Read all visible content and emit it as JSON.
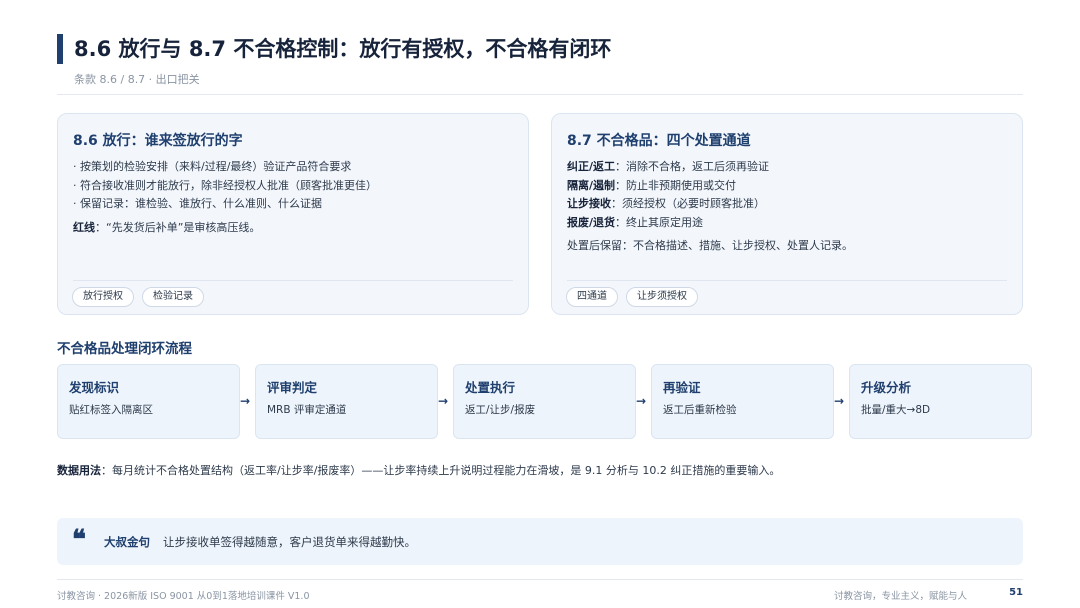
{
  "header": {
    "title": "8.6 放行与 8.7 不合格控制：放行有授权，不合格有闭环",
    "subtitle": "条款 8.6 / 8.7 · 出口把关"
  },
  "left_card": {
    "title": "8.6 放行：谁来签放行的字",
    "lines": [
      "· 按策划的检验安排（来料/过程/最终）验证产品符合要求",
      "· 符合接收准则才能放行，除非经授权人批准（顾客批准更佳）",
      "· 保留记录：谁检验、谁放行、什么准则、什么证据"
    ],
    "redline_label": "红线",
    "redline_text": "：“先发货后补单”是审核高压线。",
    "tags": [
      "放行授权",
      "检验记录"
    ]
  },
  "right_card": {
    "title": "8.7 不合格品：四个处置通道",
    "channels": [
      {
        "label": "纠正/返工",
        "text": "：消除不合格，返工后须再验证"
      },
      {
        "label": "隔离/遏制",
        "text": "：防止非预期使用或交付"
      },
      {
        "label": "让步接收",
        "text": "：须经授权（必要时顾客批准）"
      },
      {
        "label": "报废/退货",
        "text": "：终止其原定用途"
      }
    ],
    "note": "处置后保留：不合格描述、措施、让步授权、处置人记录。",
    "tags": [
      "四通道",
      "让步须授权"
    ]
  },
  "flow": {
    "title": "不合格品处理闭环流程",
    "steps": [
      {
        "title": "发现标识",
        "desc": "贴红标签入隔离区"
      },
      {
        "title": "评审判定",
        "desc": "MRB 评审定通道"
      },
      {
        "title": "处置执行",
        "desc": "返工/让步/报废"
      },
      {
        "title": "再验证",
        "desc": "返工后重新检验"
      },
      {
        "title": "升级分析",
        "desc": "批量/重大→8D"
      }
    ],
    "arrow": "→"
  },
  "usage": {
    "label": "数据用法",
    "text": "：每月统计不合格处置结构（返工率/让步率/报废率）——让步率持续上升说明过程能力在滑坡，是 9.1 分析与 10.2 纠正措施的重要输入。"
  },
  "quote": {
    "mark": "❝",
    "label": "大叔金句",
    "text": "让步接收单签得越随意，客户退货单来得越勤快。"
  },
  "footer": {
    "left": "讨教咨询 · 2026新版 ISO 9001 从0到1落地培训课件 V1.0",
    "right": "讨教咨询，专业主义，赋能与人",
    "page": "51"
  },
  "colors": {
    "accent": "#1f3f6e",
    "card_bg": "#f3f7fc",
    "flow_bg": "#eef4fb"
  }
}
